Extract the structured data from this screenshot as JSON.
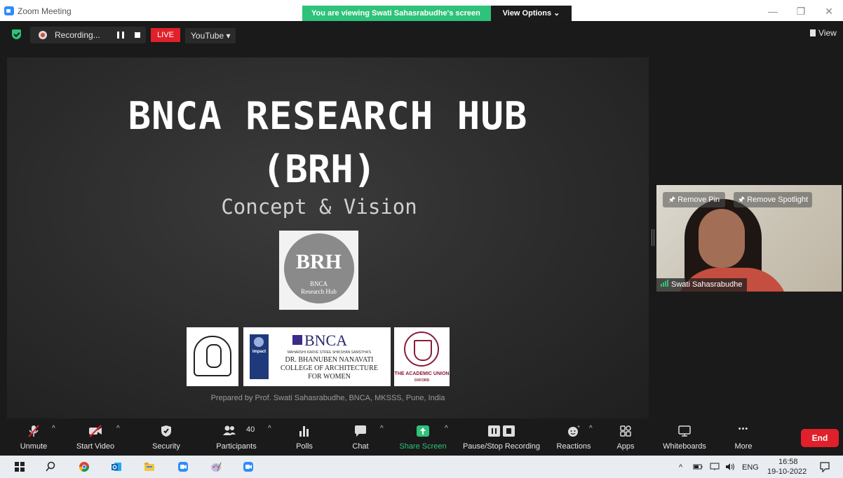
{
  "window": {
    "title": "Zoom Meeting",
    "minimize": "—",
    "restore": "❐",
    "close": "✕"
  },
  "banner": {
    "viewing_text": "You are viewing Swati Sahasrabudhe's screen",
    "view_options": "View Options ⌄"
  },
  "topbar": {
    "recording_label": "Recording...",
    "live_label": "LIVE",
    "stream_target": "YouTube ▾",
    "view_label": "View"
  },
  "slide": {
    "title_line1": "BNCA RESEARCH HUB",
    "title_line2": "(BRH)",
    "subtitle": "Concept & Vision",
    "logo_brh": {
      "big": "BRH",
      "small1": "BNCA",
      "small2": "Research Hub"
    },
    "logo_bnca": {
      "name": "BNCA",
      "impact": "impact",
      "samstha": "MAHARSHI KARVE STREE SHIKSHAN SAMSTHA'S",
      "line1": "DR. BHANUBEN NANAVATI",
      "line2": "COLLEGE OF ARCHITECTURE",
      "line3": "FOR WOMEN"
    },
    "logo_union": {
      "line1": "THE ACADEMIC UNION",
      "line2": "OXFORD"
    },
    "credit": "Prepared by Prof. Swati Sahasrabudhe, BNCA, MKSSS, Pune, India"
  },
  "video": {
    "remove_pin": "Remove Pin",
    "remove_spotlight": "Remove Spotlight",
    "participant_name": "Swati Sahasrabudhe"
  },
  "controls": {
    "unmute": "Unmute",
    "start_video": "Start Video",
    "security": "Security",
    "participants": "Participants",
    "participants_count": "40",
    "polls": "Polls",
    "chat": "Chat",
    "share_screen": "Share Screen",
    "pause_stop_recording": "Pause/Stop Recording",
    "reactions": "Reactions",
    "apps": "Apps",
    "whiteboards": "Whiteboards",
    "more": "More",
    "end": "End",
    "caret": "^",
    "more_dots": "•••"
  },
  "colors": {
    "share_green": "#2ec27a",
    "end_red": "#e0202a",
    "live_red": "#e0202a"
  },
  "taskbar": {
    "language": "ENG",
    "time": "16:58",
    "date": "19-10-2022",
    "tray_caret": "^"
  }
}
